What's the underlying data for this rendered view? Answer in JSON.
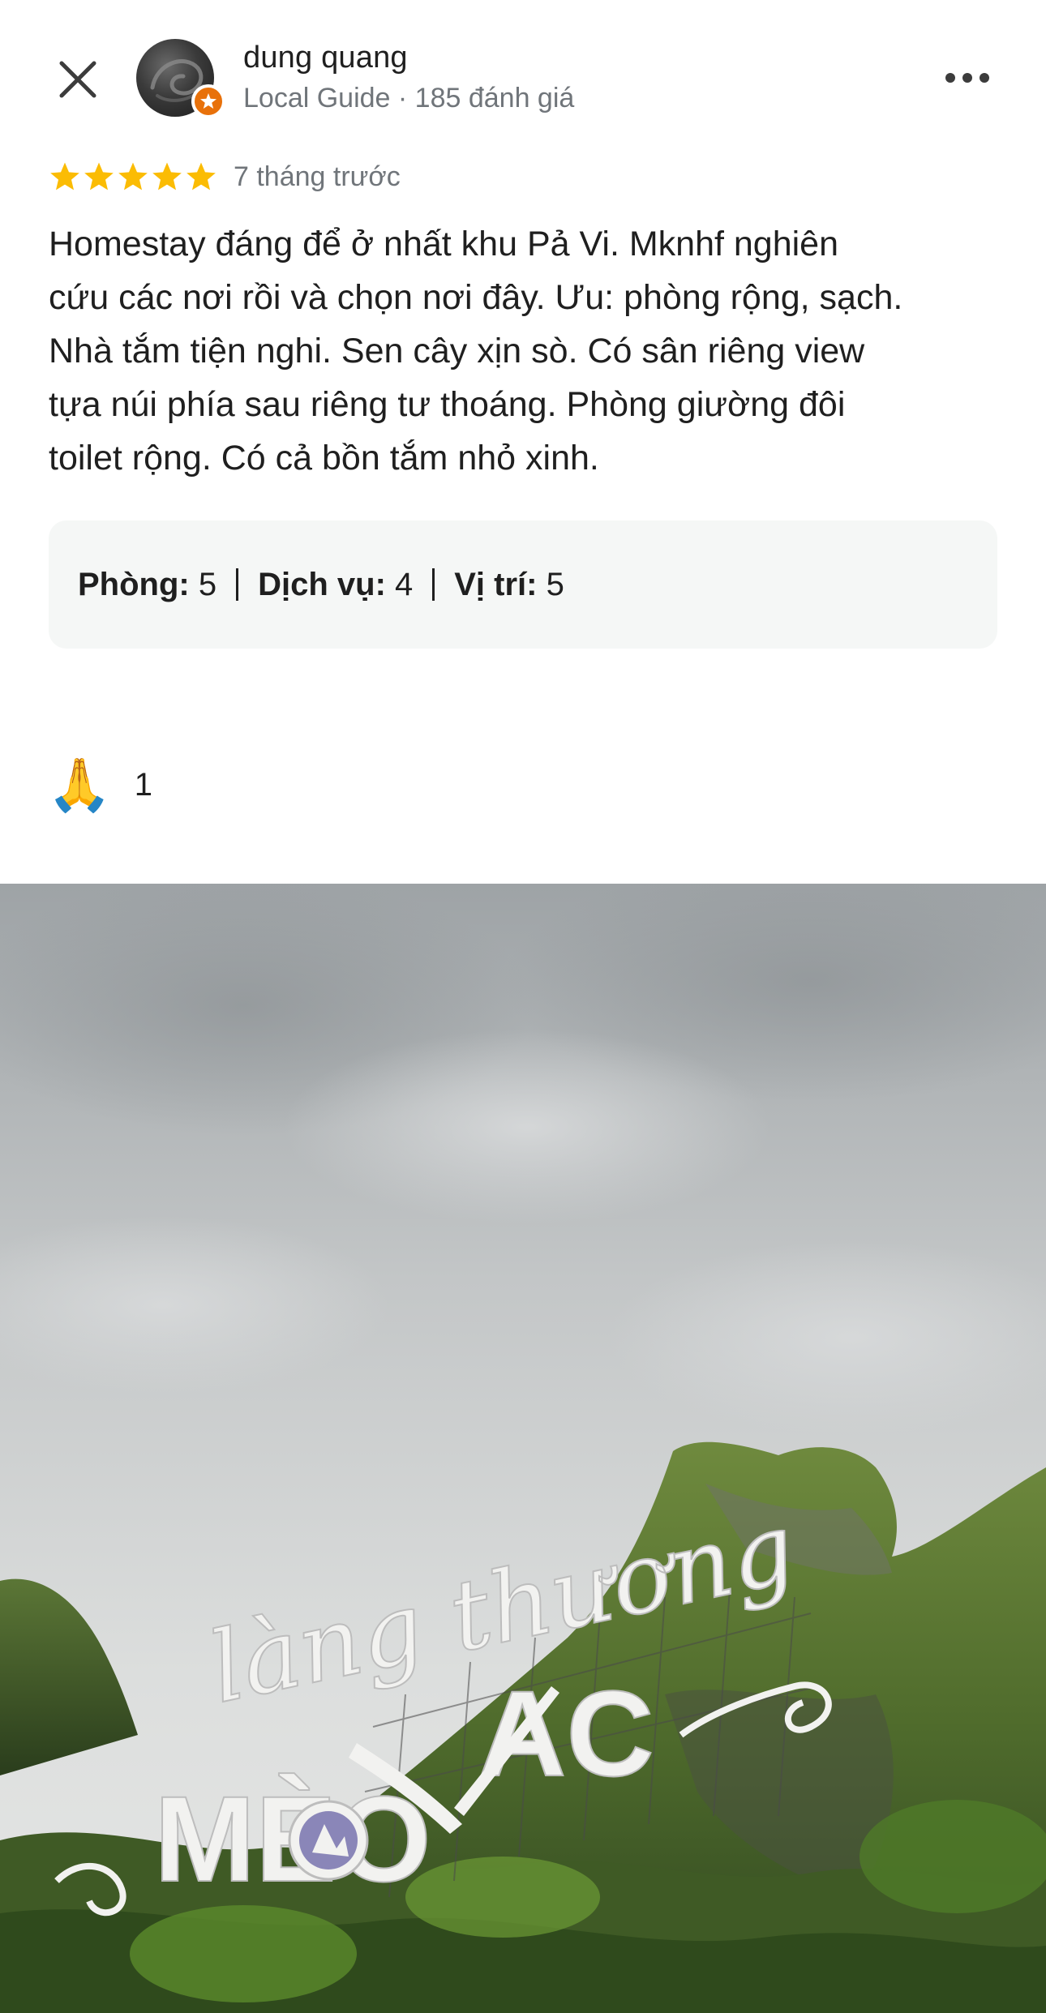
{
  "header": {
    "close_icon": "close-icon",
    "user_name": "dung quang",
    "user_meta": "Local Guide · 185 đánh giá",
    "badge_icon": "local-guide-star-icon",
    "more_icon": "more-horizontal-icon"
  },
  "review": {
    "rating": 5,
    "rating_max": 5,
    "star_color": "#fbbc04",
    "time_ago": "7 tháng trước",
    "text_lines": [
      "Homestay đáng để ở nhất khu Pả Vi. Mknhf nghiên",
      "cứu các nơi rồi và chọn nơi đây. Ưu: phòng rộng, sạch.",
      "Nhà tắm tiện nghi. Sen cây xịn sò. Có sân riêng view",
      "tựa núi phía sau riêng tư thoáng. Phòng giường đôi",
      "toilet rộng. Có cả bồn tắm nhỏ xinh."
    ]
  },
  "subratings": [
    {
      "label": "Phòng:",
      "value": "5"
    },
    {
      "label": "Dịch vụ:",
      "value": "4"
    },
    {
      "label": "Vị trí:",
      "value": "5"
    }
  ],
  "reaction": {
    "emoji": "🙏",
    "count": "1"
  },
  "photo": {
    "sign_text_top": "làng thương",
    "sign_text_left": "MÈO",
    "sign_text_right": "AC"
  },
  "colors": {
    "accent_orange": "#e8710a",
    "text_primary": "#1f1f1f",
    "text_secondary": "#70757a",
    "subrating_bg": "#f5f7f6"
  }
}
